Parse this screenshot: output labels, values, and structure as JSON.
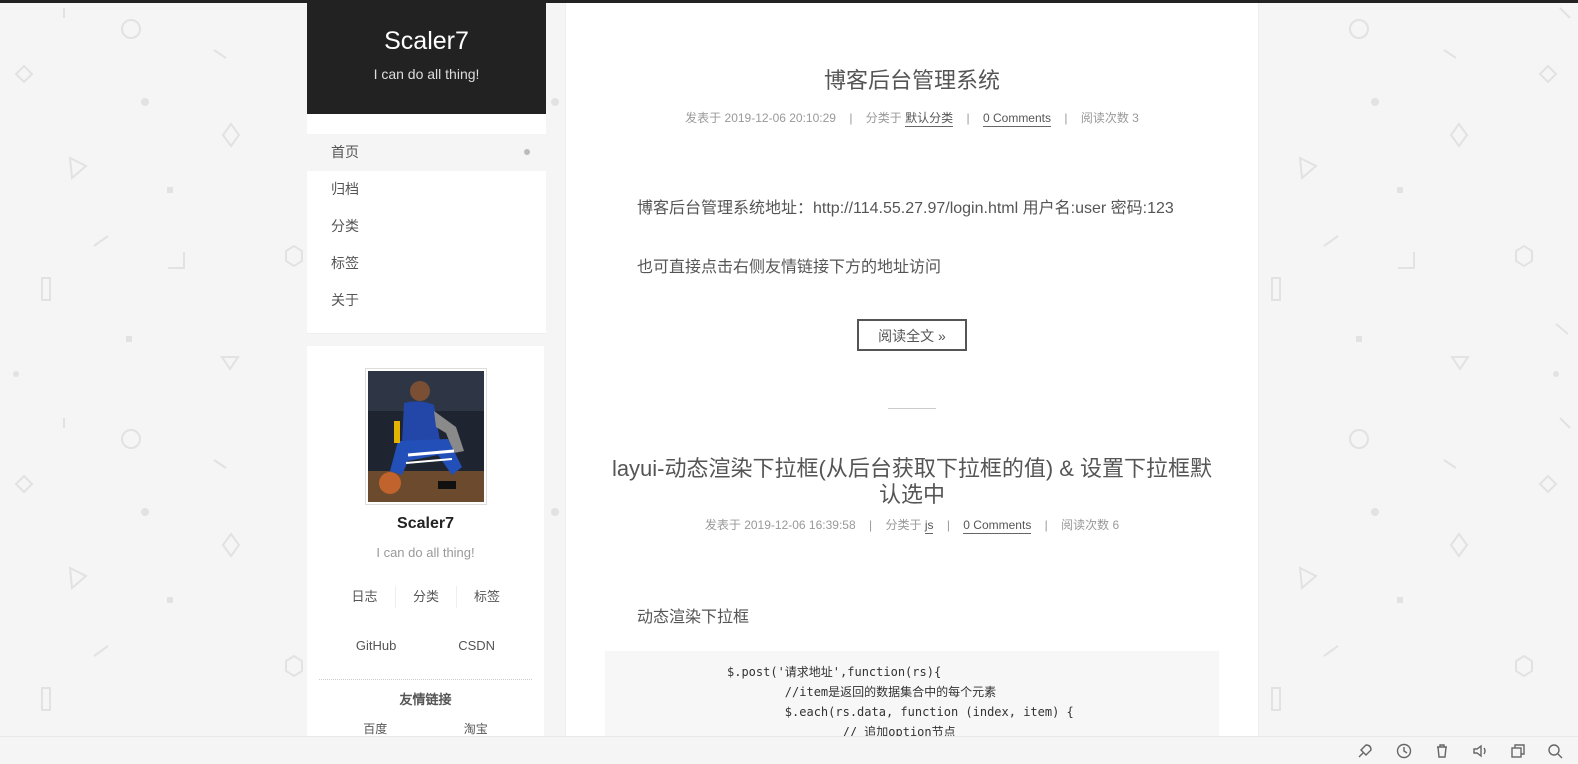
{
  "site": {
    "title": "Scaler7",
    "subtitle": "I can do all thing!"
  },
  "menu": {
    "items": [
      {
        "label": "首页"
      },
      {
        "label": "归档"
      },
      {
        "label": "分类"
      },
      {
        "label": "标签"
      },
      {
        "label": "关于"
      }
    ]
  },
  "profile": {
    "name": "Scaler7",
    "description": "I can do all thing!",
    "stats": [
      "日志",
      "分类",
      "标签"
    ],
    "social": [
      "GitHub",
      "CSDN"
    ],
    "links_title": "友情链接",
    "links": [
      "百度",
      "淘宝"
    ]
  },
  "posts": [
    {
      "title": "博客后台管理系统",
      "posted_label": "发表于",
      "date": "2019-12-06 20:10:29",
      "category_label": "分类于",
      "category": "默认分类",
      "comments": "0 Comments",
      "reads": "阅读次数 3",
      "body_line1": "博客后台管理系统地址：http://114.55.27.97/login.html 用户名:user 密码:123",
      "body_line2": "也可直接点击右侧友情链接下方的地址访问",
      "read_more": "阅读全文 »"
    },
    {
      "title": "layui-动态渲染下拉框(从后台获取下拉框的值) & 设置下拉框默认选中",
      "posted_label": "发表于",
      "date": "2019-12-06 16:39:58",
      "category_label": "分类于",
      "category": "js",
      "comments": "0 Comments",
      "reads": "阅读次数 6",
      "body_line1": "动态渲染下拉框",
      "code": [
        "$.post('请求地址',function(rs){",
        "        //item是返回的数据集合中的每个元素",
        "        $.each(rs.data, function (index, item) {",
        "                // 追加option节点"
      ]
    }
  ],
  "toolbar": {
    "icons": [
      "rocket-icon",
      "history-icon",
      "trash-icon",
      "volume-icon",
      "window-icon",
      "search-icon"
    ]
  }
}
